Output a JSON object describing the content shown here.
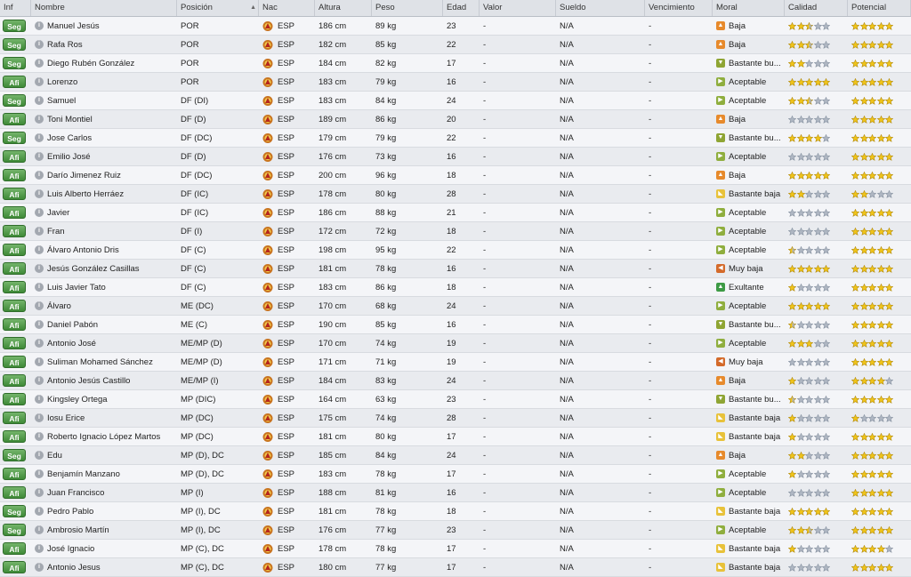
{
  "headers": {
    "inf": "Inf",
    "nombre": "Nombre",
    "posicion": "Posición",
    "nac": "Nac",
    "altura": "Altura",
    "peso": "Peso",
    "edad": "Edad",
    "valor": "Valor",
    "sueldo": "Sueldo",
    "vencimiento": "Vencimiento",
    "moral": "Moral",
    "calidad": "Calidad",
    "potencial": "Potencial"
  },
  "colors": {
    "star_full": "#f0c419",
    "star_grey": "#aeb6c2",
    "badge": "#4e9a45"
  },
  "players": [
    {
      "inf": "Seg",
      "name": "Manuel Jesús",
      "pos": "POR",
      "nac": "ESP",
      "alt": "186 cm",
      "peso": "89 kg",
      "edad": "23",
      "valor": "-",
      "sueldo": "N/A",
      "venc": "-",
      "moral": "Baja",
      "mood": "baja",
      "cal": 2.5,
      "pot": 5
    },
    {
      "inf": "Seg",
      "name": "Rafa Ros",
      "pos": "POR",
      "nac": "ESP",
      "alt": "182 cm",
      "peso": "85 kg",
      "edad": "22",
      "valor": "-",
      "sueldo": "N/A",
      "venc": "-",
      "moral": "Baja",
      "mood": "baja",
      "cal": 2.5,
      "pot": 5
    },
    {
      "inf": "Seg",
      "name": "Diego Rubén González",
      "pos": "POR",
      "nac": "ESP",
      "alt": "184 cm",
      "peso": "82 kg",
      "edad": "17",
      "valor": "-",
      "sueldo": "N/A",
      "venc": "-",
      "moral": "Bastante bu...",
      "mood": "bb",
      "cal": 2,
      "pot": 5
    },
    {
      "inf": "Afi",
      "name": "Lorenzo",
      "pos": "POR",
      "nac": "ESP",
      "alt": "183 cm",
      "peso": "79 kg",
      "edad": "16",
      "valor": "-",
      "sueldo": "N/A",
      "venc": "-",
      "moral": "Aceptable",
      "mood": "ac",
      "cal": 5,
      "pot": 5
    },
    {
      "inf": "Seg",
      "name": "Samuel",
      "pos": "DF (DI)",
      "nac": "ESP",
      "alt": "183 cm",
      "peso": "84 kg",
      "edad": "24",
      "valor": "-",
      "sueldo": "N/A",
      "venc": "-",
      "moral": "Aceptable",
      "mood": "ac",
      "cal": 2.5,
      "pot": 5
    },
    {
      "inf": "Afi",
      "name": "Toni Montiel",
      "pos": "DF (D)",
      "nac": "ESP",
      "alt": "189 cm",
      "peso": "86 kg",
      "edad": "20",
      "valor": "-",
      "sueldo": "N/A",
      "venc": "-",
      "moral": "Baja",
      "mood": "baja",
      "cal": 0,
      "pot": 5
    },
    {
      "inf": "Seg",
      "name": "Jose Carlos",
      "pos": "DF (DC)",
      "nac": "ESP",
      "alt": "179 cm",
      "peso": "79 kg",
      "edad": "22",
      "valor": "-",
      "sueldo": "N/A",
      "venc": "-",
      "moral": "Bastante bu...",
      "mood": "bb",
      "cal": 4,
      "pot": 5
    },
    {
      "inf": "Afi",
      "name": "Emilio José",
      "pos": "DF (D)",
      "nac": "ESP",
      "alt": "176 cm",
      "peso": "73 kg",
      "edad": "16",
      "valor": "-",
      "sueldo": "N/A",
      "venc": "-",
      "moral": "Aceptable",
      "mood": "ac",
      "cal": 0,
      "pot": 5
    },
    {
      "inf": "Afi",
      "name": "Darío Jimenez Ruiz",
      "pos": "DF (DC)",
      "nac": "ESP",
      "alt": "200 cm",
      "peso": "96 kg",
      "edad": "18",
      "valor": "-",
      "sueldo": "N/A",
      "venc": "-",
      "moral": "Baja",
      "mood": "baja",
      "cal": 5,
      "pot": 5
    },
    {
      "inf": "Afi",
      "name": "Luis Alberto Herráez",
      "pos": "DF (IC)",
      "nac": "ESP",
      "alt": "178 cm",
      "peso": "80 kg",
      "edad": "28",
      "valor": "-",
      "sueldo": "N/A",
      "venc": "-",
      "moral": "Bastante baja",
      "mood": "bj",
      "cal": 2,
      "pot": 2
    },
    {
      "inf": "Afi",
      "name": "Javier",
      "pos": "DF (IC)",
      "nac": "ESP",
      "alt": "186 cm",
      "peso": "88 kg",
      "edad": "21",
      "valor": "-",
      "sueldo": "N/A",
      "venc": "-",
      "moral": "Aceptable",
      "mood": "ac",
      "cal": 0,
      "pot": 5
    },
    {
      "inf": "Afi",
      "name": "Fran",
      "pos": "DF (I)",
      "nac": "ESP",
      "alt": "172 cm",
      "peso": "72 kg",
      "edad": "18",
      "valor": "-",
      "sueldo": "N/A",
      "venc": "-",
      "moral": "Aceptable",
      "mood": "ac",
      "cal": 0,
      "pot": 5
    },
    {
      "inf": "Afi",
      "name": "Álvaro Antonio Dris",
      "pos": "DF (C)",
      "nac": "ESP",
      "alt": "198 cm",
      "peso": "95 kg",
      "edad": "22",
      "valor": "-",
      "sueldo": "N/A",
      "venc": "-",
      "moral": "Aceptable",
      "mood": "ac",
      "cal": 0.5,
      "pot": 5
    },
    {
      "inf": "Afi",
      "name": "Jesús González Casillas",
      "pos": "DF (C)",
      "nac": "ESP",
      "alt": "181 cm",
      "peso": "78 kg",
      "edad": "16",
      "valor": "-",
      "sueldo": "N/A",
      "venc": "-",
      "moral": "Muy baja",
      "mood": "mb",
      "cal": 5,
      "pot": 5
    },
    {
      "inf": "Afi",
      "name": "Luis Javier Tato",
      "pos": "DF (C)",
      "nac": "ESP",
      "alt": "183 cm",
      "peso": "86 kg",
      "edad": "18",
      "valor": "-",
      "sueldo": "N/A",
      "venc": "-",
      "moral": "Exultante",
      "mood": "ex",
      "cal": 1,
      "pot": 5
    },
    {
      "inf": "Afi",
      "name": "Álvaro",
      "pos": "ME (DC)",
      "nac": "ESP",
      "alt": "170 cm",
      "peso": "68 kg",
      "edad": "24",
      "valor": "-",
      "sueldo": "N/A",
      "venc": "-",
      "moral": "Aceptable",
      "mood": "ac",
      "cal": 5,
      "pot": 5
    },
    {
      "inf": "Afi",
      "name": "Daniel Pabón",
      "pos": "ME (C)",
      "nac": "ESP",
      "alt": "190 cm",
      "peso": "85 kg",
      "edad": "16",
      "valor": "-",
      "sueldo": "N/A",
      "venc": "-",
      "moral": "Bastante bu...",
      "mood": "bb",
      "cal": 0.5,
      "pot": 5
    },
    {
      "inf": "Afi",
      "name": "Antonio José",
      "pos": "ME/MP (D)",
      "nac": "ESP",
      "alt": "170 cm",
      "peso": "74 kg",
      "edad": "19",
      "valor": "-",
      "sueldo": "N/A",
      "venc": "-",
      "moral": "Aceptable",
      "mood": "ac",
      "cal": 3,
      "pot": 5
    },
    {
      "inf": "Afi",
      "name": "Suliman Mohamed Sánchez",
      "pos": "ME/MP (D)",
      "nac": "ESP",
      "alt": "171 cm",
      "peso": "71 kg",
      "edad": "19",
      "valor": "-",
      "sueldo": "N/A",
      "venc": "-",
      "moral": "Muy baja",
      "mood": "mb",
      "cal": 0,
      "pot": 5
    },
    {
      "inf": "Afi",
      "name": "Antonio Jesús Castillo",
      "pos": "ME/MP (I)",
      "nac": "ESP",
      "alt": "184 cm",
      "peso": "83 kg",
      "edad": "24",
      "valor": "-",
      "sueldo": "N/A",
      "venc": "-",
      "moral": "Baja",
      "mood": "baja",
      "cal": 1,
      "pot": 4
    },
    {
      "inf": "Afi",
      "name": "Kingsley Ortega",
      "pos": "MP (DIC)",
      "nac": "ESP",
      "alt": "164 cm",
      "peso": "63 kg",
      "edad": "23",
      "valor": "-",
      "sueldo": "N/A",
      "venc": "-",
      "moral": "Bastante bu...",
      "mood": "bb",
      "cal": 0.5,
      "pot": 5
    },
    {
      "inf": "Afi",
      "name": "Iosu Erice",
      "pos": "MP (DC)",
      "nac": "ESP",
      "alt": "175 cm",
      "peso": "74 kg",
      "edad": "28",
      "valor": "-",
      "sueldo": "N/A",
      "venc": "-",
      "moral": "Bastante baja",
      "mood": "bj",
      "cal": 1,
      "pot": 1
    },
    {
      "inf": "Afi",
      "name": "Roberto Ignacio López Martos",
      "pos": "MP (DC)",
      "nac": "ESP",
      "alt": "181 cm",
      "peso": "80 kg",
      "edad": "17",
      "valor": "-",
      "sueldo": "N/A",
      "venc": "-",
      "moral": "Bastante baja",
      "mood": "bj",
      "cal": 1,
      "pot": 5
    },
    {
      "inf": "Seg",
      "name": "Edu",
      "pos": "MP (D), DC",
      "nac": "ESP",
      "alt": "185 cm",
      "peso": "84 kg",
      "edad": "24",
      "valor": "-",
      "sueldo": "N/A",
      "venc": "-",
      "moral": "Baja",
      "mood": "baja",
      "cal": 2,
      "pot": 5
    },
    {
      "inf": "Afi",
      "name": "Benjamín Manzano",
      "pos": "MP (D), DC",
      "nac": "ESP",
      "alt": "183 cm",
      "peso": "78 kg",
      "edad": "17",
      "valor": "-",
      "sueldo": "N/A",
      "venc": "-",
      "moral": "Aceptable",
      "mood": "ac",
      "cal": 1,
      "pot": 5
    },
    {
      "inf": "Afi",
      "name": "Juan Francisco",
      "pos": "MP (I)",
      "nac": "ESP",
      "alt": "188 cm",
      "peso": "81 kg",
      "edad": "16",
      "valor": "-",
      "sueldo": "N/A",
      "venc": "-",
      "moral": "Aceptable",
      "mood": "ac",
      "cal": 0,
      "pot": 5
    },
    {
      "inf": "Seg",
      "name": "Pedro Pablo",
      "pos": "MP (I), DC",
      "nac": "ESP",
      "alt": "181 cm",
      "peso": "78 kg",
      "edad": "18",
      "valor": "-",
      "sueldo": "N/A",
      "venc": "-",
      "moral": "Bastante baja",
      "mood": "bj",
      "cal": 5,
      "pot": 5
    },
    {
      "inf": "Seg",
      "name": "Ambrosio Martín",
      "pos": "MP (I), DC",
      "nac": "ESP",
      "alt": "176 cm",
      "peso": "77 kg",
      "edad": "23",
      "valor": "-",
      "sueldo": "N/A",
      "venc": "-",
      "moral": "Aceptable",
      "mood": "ac",
      "cal": 2.5,
      "pot": 5
    },
    {
      "inf": "Afi",
      "name": "José Ignacio",
      "pos": "MP (C), DC",
      "nac": "ESP",
      "alt": "178 cm",
      "peso": "78 kg",
      "edad": "17",
      "valor": "-",
      "sueldo": "N/A",
      "venc": "-",
      "moral": "Bastante baja",
      "mood": "bj",
      "cal": 1,
      "pot": 4
    },
    {
      "inf": "Afi",
      "name": "Antonio Jesus",
      "pos": "MP (C), DC",
      "nac": "ESP",
      "alt": "180 cm",
      "peso": "77 kg",
      "edad": "17",
      "valor": "-",
      "sueldo": "N/A",
      "venc": "-",
      "moral": "Bastante baja",
      "mood": "bj",
      "cal": 0,
      "pot": 5
    }
  ]
}
